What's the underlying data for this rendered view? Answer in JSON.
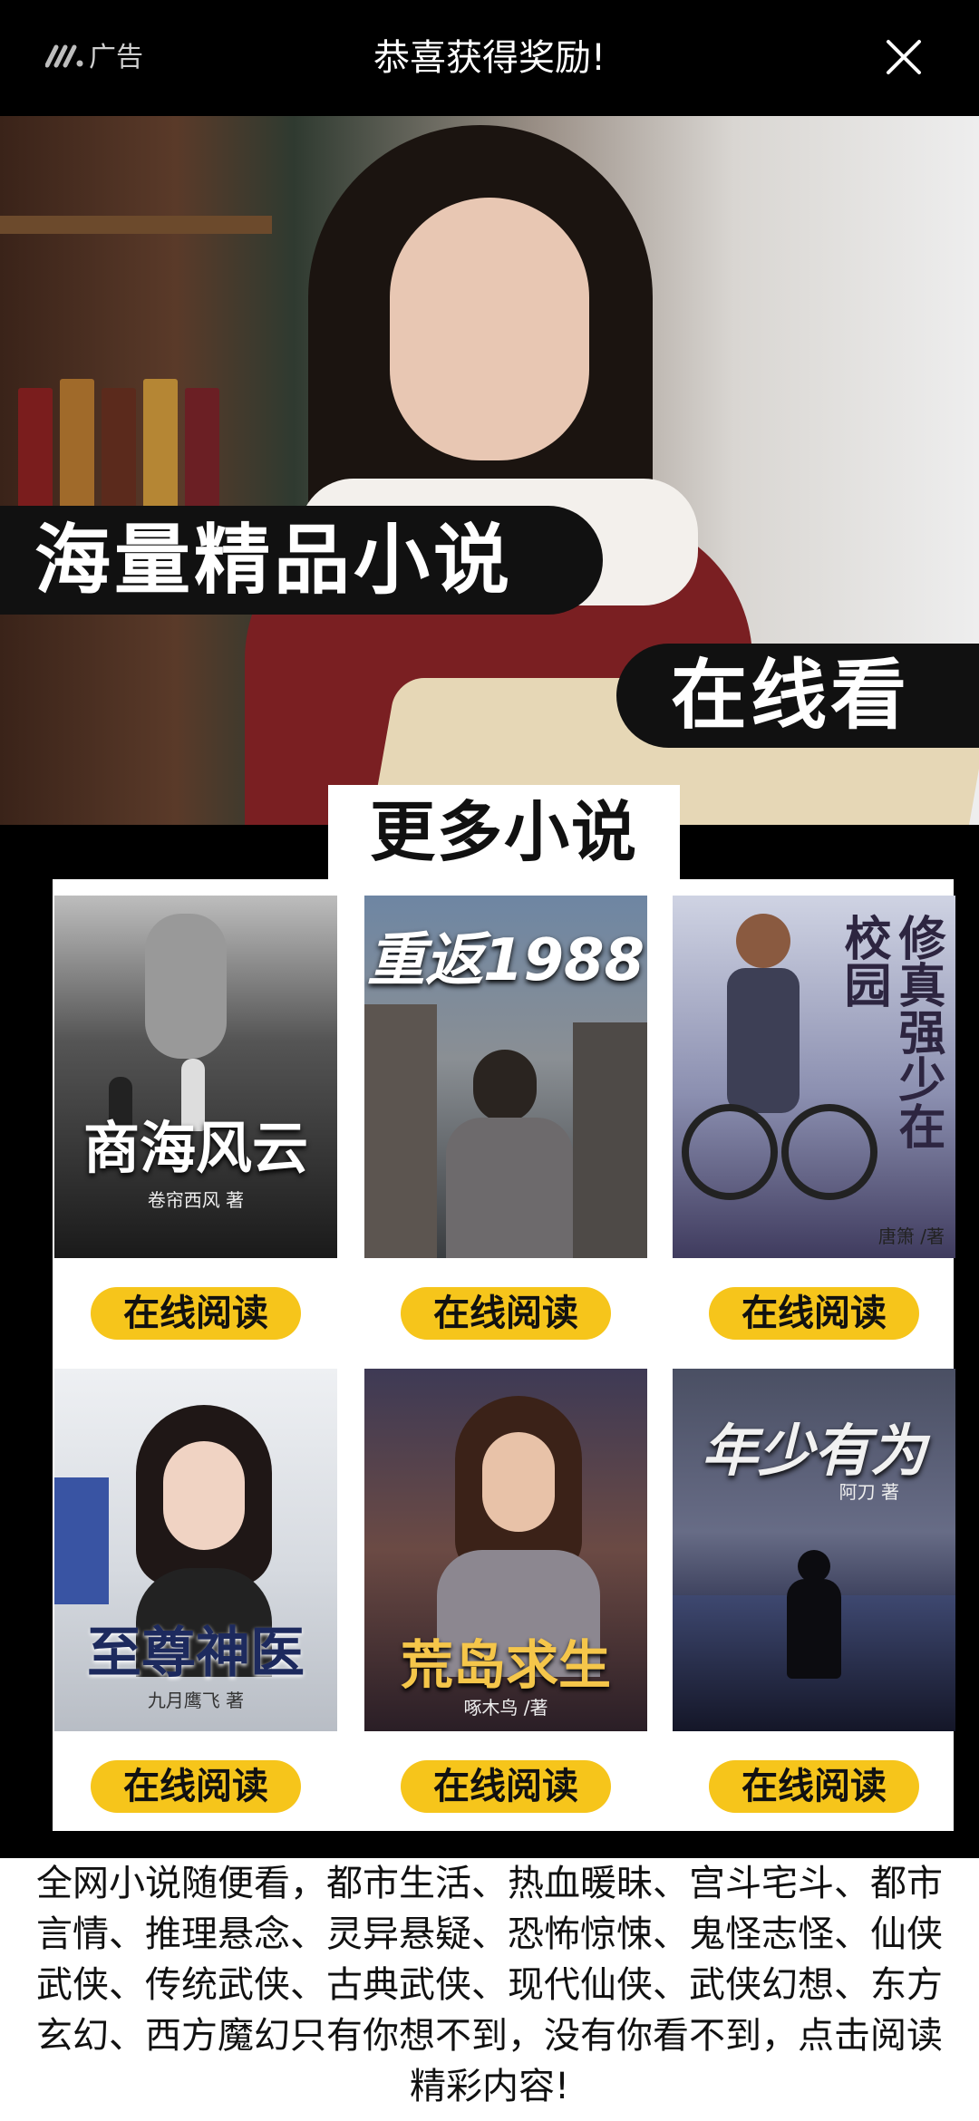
{
  "topbar": {
    "ad_label": "广告",
    "title": "恭喜获得奖励!"
  },
  "hero": {
    "badge_primary": "海量精品小说",
    "badge_secondary": "在线看"
  },
  "section": {
    "label": "更多小说"
  },
  "books": [
    {
      "title": "商海风云",
      "author": "卷帘西风 著",
      "button": "在线阅读"
    },
    {
      "title": "重返1988",
      "author": "",
      "button": "在线阅读"
    },
    {
      "title": "修真强少在校园",
      "author": "唐箫 /著",
      "button": "在线阅读"
    },
    {
      "title": "至尊神医",
      "author": "九月鹰飞 著",
      "button": "在线阅读"
    },
    {
      "title": "荒岛求生",
      "author": "啄木鸟 /著",
      "button": "在线阅读"
    },
    {
      "title": "年少有为",
      "author": "阿刀 著",
      "button": "在线阅读"
    }
  ],
  "description": "全网小说随便看，都市生活、热血暖昧、宫斗宅斗、都市言情、推理悬念、灵异悬疑、恐怖惊悚、鬼怪志怪、仙侠武侠、传统武侠、古典武侠、现代仙侠、武侠幻想、东方玄幻、西方魔幻只有你想不到，没有你看不到，点击阅读精彩内容!",
  "colors": {
    "accent_button": "#f6c51b",
    "background": "#000000"
  },
  "icons": {
    "ad_logo": "ad-logo-icon",
    "close": "close-icon"
  }
}
